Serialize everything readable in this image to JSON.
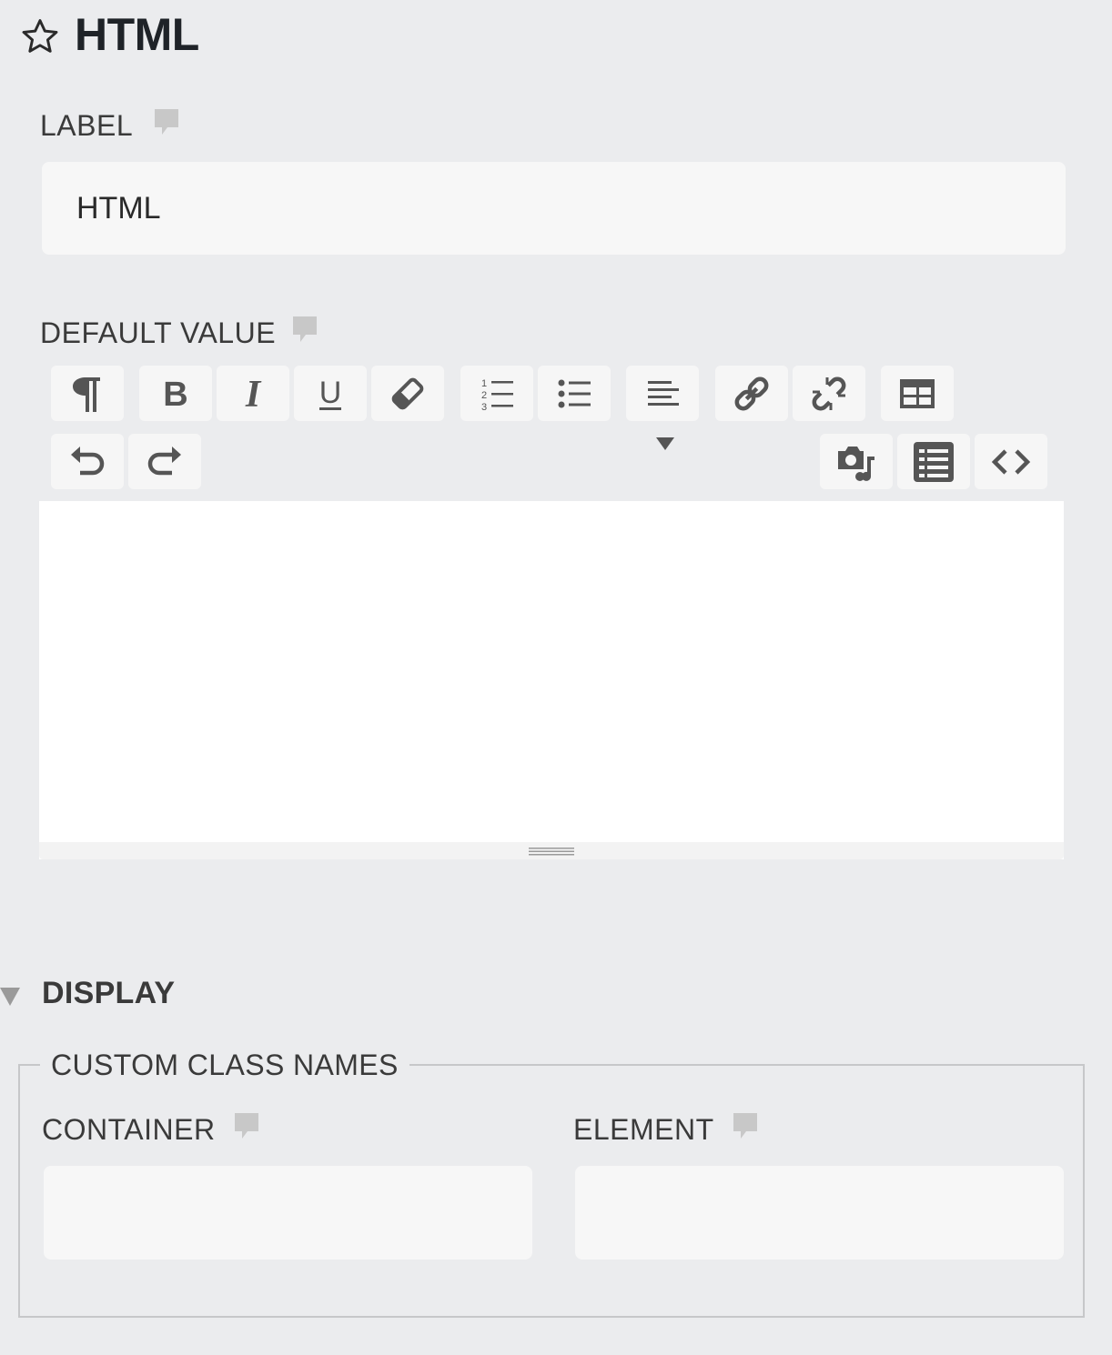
{
  "header": {
    "title": "HTML",
    "star_icon": "star-outline-icon"
  },
  "label_field": {
    "label": "LABEL",
    "value": "HTML",
    "help_icon": "comment-icon"
  },
  "default_value": {
    "label": "DEFAULT VALUE",
    "help_icon": "comment-icon",
    "toolbar_row1": [
      "paragraph-icon",
      "bold-icon",
      "italic-icon",
      "underline-icon",
      "eraser-icon",
      "ordered-list-icon",
      "bullet-list-icon",
      "align-left-icon",
      "link-icon",
      "unlink-icon",
      "table-icon"
    ],
    "toolbar_row2": [
      "undo-icon",
      "redo-icon",
      "media-icon",
      "source-list-icon",
      "code-icon"
    ],
    "editor_content": ""
  },
  "display_section": {
    "title": "DISPLAY",
    "collapse_icon": "caret-down-icon",
    "fieldset_legend": "CUSTOM CLASS NAMES",
    "container": {
      "label": "CONTAINER",
      "value": ""
    },
    "element": {
      "label": "ELEMENT",
      "value": ""
    }
  },
  "colors": {
    "background": "#ebecee",
    "input_bg": "#f7f7f7",
    "button_bg": "#f6f6f6",
    "icon": "#555555",
    "help_icon": "#c8c8c8"
  }
}
